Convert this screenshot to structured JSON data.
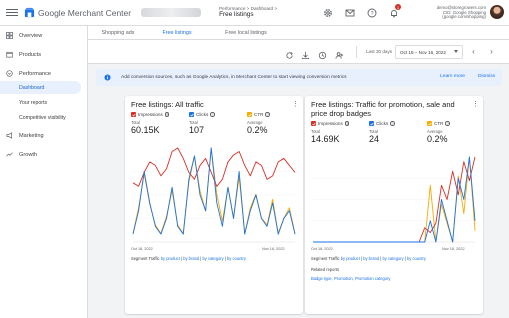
{
  "app": {
    "name_bold": "Google",
    "name": "Merchant Center",
    "breadcrumb": "Performance > Dashboard >",
    "page": "Free listings",
    "account_email": "demo@storegrowers.com",
    "account_cid": "CID: Google Shopping (google.com/shopping)",
    "notification_count": "1"
  },
  "sidebar": {
    "items": [
      {
        "label": "Overview",
        "icon": "grid-icon"
      },
      {
        "label": "Products",
        "icon": "box-icon"
      },
      {
        "label": "Performance",
        "icon": "chevron-icon"
      }
    ],
    "sub_items": [
      {
        "label": "Dashboard",
        "active": true
      },
      {
        "label": "Your reports",
        "active": false
      },
      {
        "label": "Competitive visibility",
        "active": false
      }
    ],
    "items_after": [
      {
        "label": "Marketing",
        "icon": "megaphone-icon"
      },
      {
        "label": "Growth",
        "icon": "trend-icon"
      }
    ]
  },
  "tabs": [
    "Shopping ads",
    "Free listings",
    "Free local listings"
  ],
  "active_tab": 1,
  "toolbar": {
    "range_label": "Last 30 days",
    "date_range": "Oct 18 – Nov 16, 2022"
  },
  "banner": {
    "message": "Add conversion sources, such as Google Analytics, in Merchant Center to start viewing conversion metrics",
    "learn_more": "Learn more",
    "dismiss": "Dismiss"
  },
  "colors": {
    "impressions": "#d93025",
    "clicks": "#1a73e8",
    "ctr": "#f9ab00",
    "accent": "#1a73e8"
  },
  "cards": [
    {
      "title": "Free listings: All traffic",
      "metrics": [
        {
          "name": "Impressions",
          "label": "Total",
          "value": "60.15K"
        },
        {
          "name": "Clicks",
          "label": "Total",
          "value": "107"
        },
        {
          "name": "CTR",
          "label": "Average",
          "value": "0.2%"
        }
      ],
      "date_start": "Oct 18, 2022",
      "date_end": "Nov 16, 2022",
      "segment_label": "Segment Traffic",
      "segment_links": [
        "by product",
        "by brand",
        "by category",
        "by country"
      ]
    },
    {
      "title": "Free listings: Traffic for promotion, sale and price drop badges",
      "metrics": [
        {
          "name": "Impressions",
          "label": "Total",
          "value": "14.69K"
        },
        {
          "name": "Clicks",
          "label": "Total",
          "value": "24"
        },
        {
          "name": "CTR",
          "label": "Average",
          "value": "0.2%"
        }
      ],
      "date_start": "Oct 18, 2022",
      "date_end": "Nov 16, 2022",
      "segment_label": "Segment Traffic",
      "segment_links": [
        "by product",
        "by brand",
        "by category",
        "by country"
      ],
      "related_title": "Related reports",
      "related_links": [
        "Badge type",
        "Promotion",
        "Promotion category"
      ]
    }
  ],
  "chart_data": [
    {
      "type": "line",
      "title": "Free listings: All traffic",
      "x": [
        "Oct 18",
        "Oct 19",
        "Oct 20",
        "Oct 21",
        "Oct 22",
        "Oct 23",
        "Oct 24",
        "Oct 25",
        "Oct 26",
        "Oct 27",
        "Oct 28",
        "Oct 29",
        "Oct 30",
        "Oct 31",
        "Nov 1",
        "Nov 2",
        "Nov 3",
        "Nov 4",
        "Nov 5",
        "Nov 6",
        "Nov 7",
        "Nov 8",
        "Nov 9",
        "Nov 10",
        "Nov 11",
        "Nov 12",
        "Nov 13",
        "Nov 14",
        "Nov 15",
        "Nov 16"
      ],
      "series": [
        {
          "name": "Impressions",
          "values": [
            1.7,
            1.6,
            2.0,
            2.3,
            2.2,
            1.9,
            2.1,
            2.6,
            2.7,
            2.4,
            2.0,
            1.8,
            2.2,
            2.4,
            2.0,
            1.6,
            1.8,
            2.3,
            2.5,
            2.6,
            2.2,
            1.9,
            2.3,
            2.2,
            1.8,
            1.9,
            2.3,
            2.4,
            2.2,
            2.0
          ]
        },
        {
          "name": "Clicks",
          "values": [
            1,
            4,
            9,
            5,
            2,
            1,
            3,
            7,
            2,
            1,
            8,
            11,
            6,
            4,
            12,
            5,
            2,
            7,
            3,
            9,
            1,
            4,
            6,
            3,
            2,
            5,
            1,
            3,
            4,
            1
          ]
        },
        {
          "name": "CTR",
          "values": [
            0.05,
            0.2,
            0.4,
            0.22,
            0.1,
            0.05,
            0.15,
            0.3,
            0.1,
            0.05,
            0.35,
            0.5,
            0.3,
            0.18,
            0.55,
            0.28,
            0.12,
            0.32,
            0.14,
            0.38,
            0.05,
            0.2,
            0.28,
            0.14,
            0.1,
            0.25,
            0.05,
            0.14,
            0.2,
            0.05
          ]
        }
      ]
    },
    {
      "type": "line",
      "title": "Free listings: Traffic for promotion, sale and price drop badges",
      "x": [
        "Oct 18",
        "Oct 19",
        "Oct 20",
        "Oct 21",
        "Oct 22",
        "Oct 23",
        "Oct 24",
        "Oct 25",
        "Oct 26",
        "Oct 27",
        "Oct 28",
        "Oct 29",
        "Oct 30",
        "Oct 31",
        "Nov 1",
        "Nov 2",
        "Nov 3",
        "Nov 4",
        "Nov 5",
        "Nov 6",
        "Nov 7",
        "Nov 8",
        "Nov 9",
        "Nov 10",
        "Nov 11",
        "Nov 12",
        "Nov 13",
        "Nov 14",
        "Nov 15",
        "Nov 16"
      ],
      "series": [
        {
          "name": "Impressions",
          "values": [
            0,
            0,
            0,
            0,
            0,
            0,
            0,
            0,
            0,
            0,
            0,
            0,
            0,
            0,
            0,
            0,
            0,
            0,
            0,
            0,
            0.3,
            0.2,
            0.4,
            1.2,
            0.9,
            1.5,
            1.0,
            1.7,
            1.3,
            1.8
          ]
        },
        {
          "name": "Clicks",
          "values": [
            0,
            0,
            0,
            0,
            0,
            0,
            0,
            0,
            0,
            0,
            0,
            0,
            0,
            0,
            0,
            0,
            0,
            0,
            0,
            0,
            0,
            1,
            0,
            2,
            1,
            0,
            3,
            2,
            4,
            1
          ]
        },
        {
          "name": "CTR",
          "values": [
            0,
            0,
            0,
            0,
            0,
            0,
            0,
            0,
            0,
            0,
            0,
            0,
            0,
            0,
            0,
            0,
            0,
            0,
            0,
            0,
            0,
            0.3,
            0,
            0.2,
            0.1,
            0,
            0.35,
            0.15,
            0.45,
            0.06
          ]
        }
      ]
    }
  ]
}
